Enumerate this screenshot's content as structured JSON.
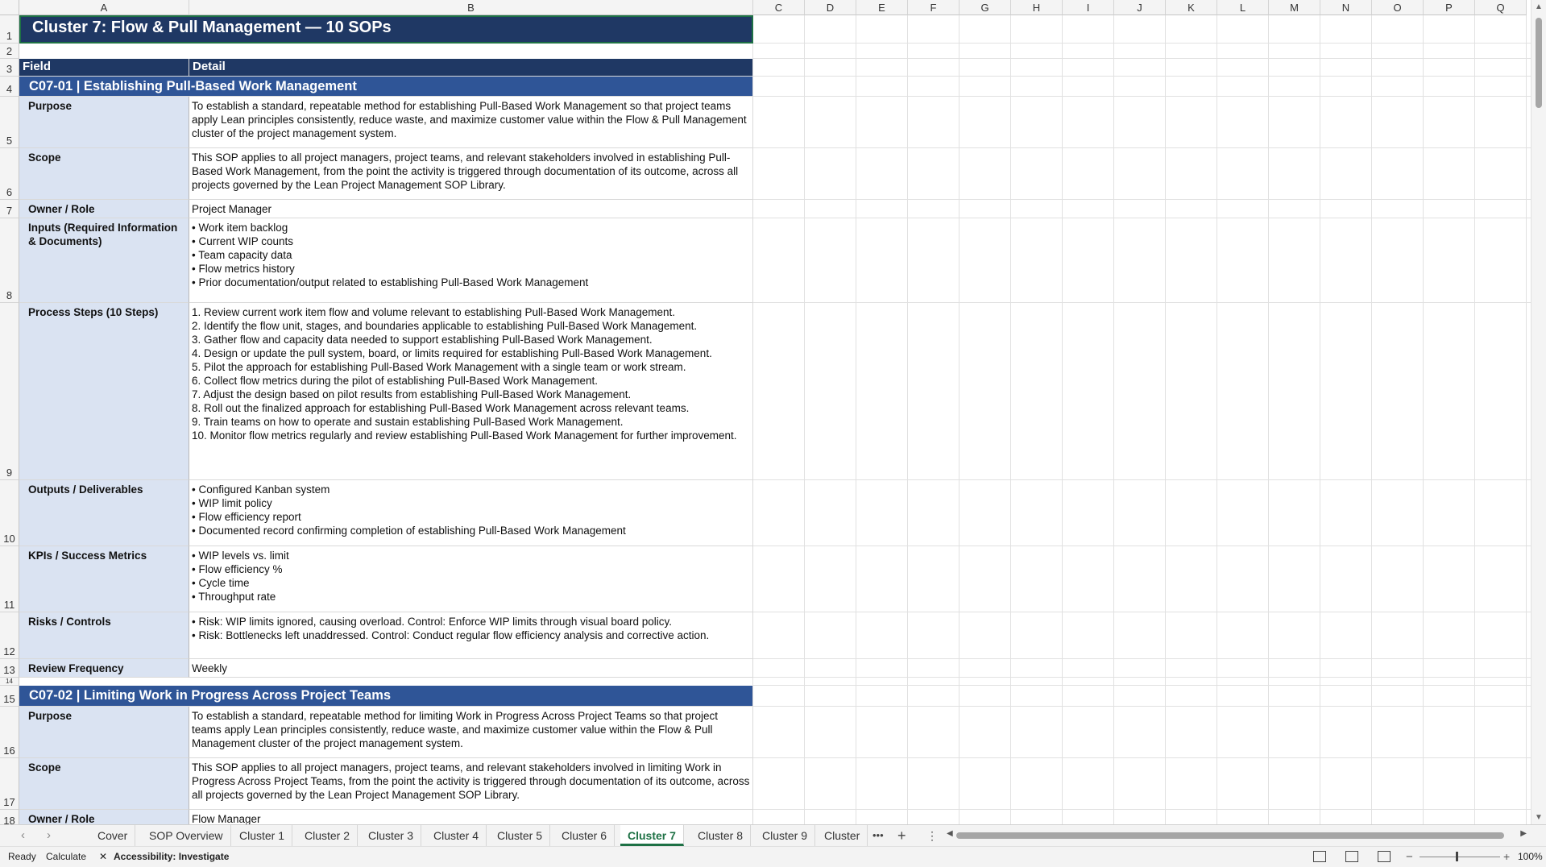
{
  "columns": [
    "A",
    "B",
    "C",
    "D",
    "E",
    "F",
    "G",
    "H",
    "I",
    "J",
    "K",
    "L",
    "M",
    "N",
    "O",
    "P",
    "Q"
  ],
  "rows": [
    "1",
    "2",
    "3",
    "4",
    "5",
    "6",
    "7",
    "8",
    "9",
    "10",
    "11",
    "12",
    "13",
    "14",
    "15",
    "16",
    "17",
    "18"
  ],
  "title": "Cluster 7: Flow & Pull Management  —  10 SOPs",
  "table_headers": {
    "field": "Field",
    "detail": "Detail"
  },
  "sop1": {
    "heading": "C07-01  |  Establishing Pull-Based Work Management",
    "purpose_label": "Purpose",
    "purpose": "To establish a standard, repeatable method for establishing Pull-Based Work Management so that project teams apply Lean principles consistently, reduce waste, and maximize customer value within the Flow & Pull Management cluster of the project management system.",
    "scope_label": "Scope",
    "scope": "This SOP applies to all project managers, project teams, and relevant stakeholders involved in establishing Pull-Based Work Management, from the point the activity is triggered through documentation of its outcome, across all projects governed by the Lean Project Management SOP Library.",
    "owner_label": "Owner / Role",
    "owner": "Project Manager",
    "inputs_label": "Inputs (Required Information & Documents)",
    "inputs": "• Work item backlog\n• Current WIP counts\n• Team capacity data\n• Flow metrics history\n• Prior documentation/output related to establishing Pull-Based Work Management",
    "steps_label": "Process Steps (10 Steps)",
    "steps": "1. Review current work item flow and volume relevant to establishing Pull-Based Work Management.\n2. Identify the flow unit, stages, and boundaries applicable to establishing Pull-Based Work Management.\n3. Gather flow and capacity data needed to support establishing Pull-Based Work Management.\n4. Design or update the pull system, board, or limits required for establishing Pull-Based Work Management.\n5. Pilot the approach for establishing Pull-Based Work Management with a single team or work stream.\n6. Collect flow metrics during the pilot of establishing Pull-Based Work Management.\n7. Adjust the design based on pilot results from establishing Pull-Based Work Management.\n8. Roll out the finalized approach for establishing Pull-Based Work Management across relevant teams.\n9. Train teams on how to operate and sustain establishing Pull-Based Work Management.\n10. Monitor flow metrics regularly and review establishing Pull-Based Work Management for further improvement.",
    "outputs_label": "Outputs / Deliverables",
    "outputs": "• Configured Kanban system\n• WIP limit policy\n• Flow efficiency report\n• Documented record confirming completion of establishing Pull-Based Work Management",
    "kpis_label": "KPIs / Success Metrics",
    "kpis": "• WIP levels vs. limit\n• Flow efficiency %\n• Cycle time\n• Throughput rate",
    "risks_label": "Risks / Controls",
    "risks": "• Risk: WIP limits ignored, causing overload. Control: Enforce WIP limits through visual board policy.\n• Risk: Bottlenecks left unaddressed. Control: Conduct regular flow efficiency analysis and corrective action.",
    "review_label": "Review Frequency",
    "review": "Weekly"
  },
  "sop2": {
    "heading": "C07-02  |  Limiting Work in Progress Across Project Teams",
    "purpose_label": "Purpose",
    "purpose": "To establish a standard, repeatable method for limiting Work in Progress Across Project Teams so that project teams apply Lean principles consistently, reduce waste, and maximize customer value within the Flow & Pull Management cluster of the project management system.",
    "scope_label": "Scope",
    "scope": "This SOP applies to all project managers, project teams, and relevant stakeholders involved in limiting Work in Progress Across Project Teams, from the point the activity is triggered through documentation of its outcome, across all projects governed by the Lean Project Management SOP Library.",
    "owner_label": "Owner / Role",
    "owner": "Flow Manager"
  },
  "sheet_tabs": [
    "Cover",
    "SOP Overview",
    "Cluster 1",
    "Cluster 2",
    "Cluster 3",
    "Cluster 4",
    "Cluster 5",
    "Cluster 6",
    "Cluster 7",
    "Cluster 8",
    "Cluster 9",
    "Cluster"
  ],
  "active_tab": "Cluster 7",
  "status": {
    "ready": "Ready",
    "calculate": "Calculate",
    "accessibility": "Accessibility: Investigate",
    "zoom": "100%"
  }
}
